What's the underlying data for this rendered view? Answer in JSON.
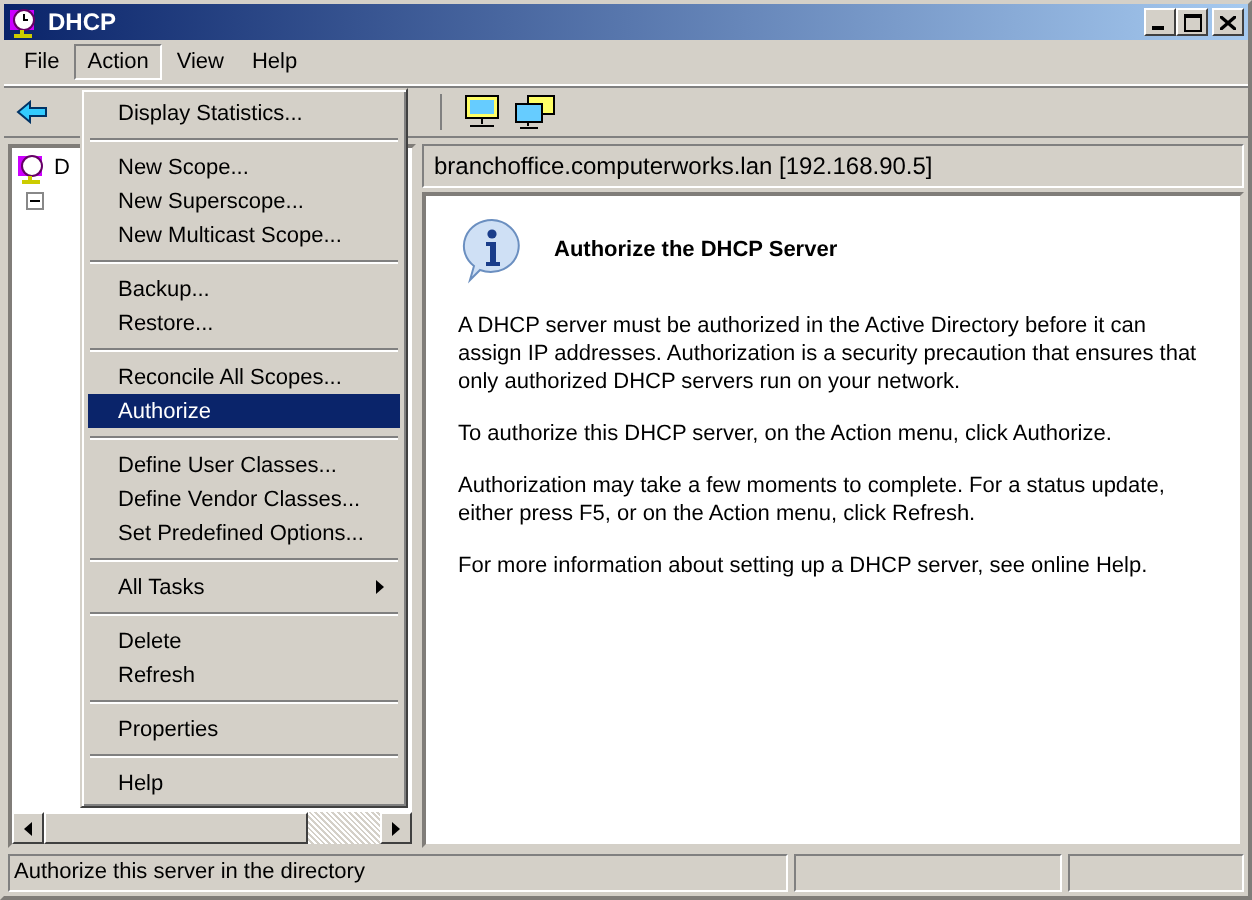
{
  "window": {
    "title": "DHCP"
  },
  "menu_bar": [
    {
      "label": "File",
      "selected": false
    },
    {
      "label": "Action",
      "selected": true
    },
    {
      "label": "View",
      "selected": false
    },
    {
      "label": "Help",
      "selected": false
    }
  ],
  "action_menu": [
    {
      "kind": "item",
      "label": "Display Statistics...",
      "selected": false
    },
    {
      "kind": "separator"
    },
    {
      "kind": "item",
      "label": "New Scope...",
      "selected": false
    },
    {
      "kind": "item",
      "label": "New Superscope...",
      "selected": false
    },
    {
      "kind": "item",
      "label": "New Multicast Scope...",
      "selected": false
    },
    {
      "kind": "separator"
    },
    {
      "kind": "item",
      "label": "Backup...",
      "selected": false
    },
    {
      "kind": "item",
      "label": "Restore...",
      "selected": false
    },
    {
      "kind": "separator"
    },
    {
      "kind": "item",
      "label": "Reconcile All Scopes...",
      "selected": false
    },
    {
      "kind": "item",
      "label": "Authorize",
      "selected": true
    },
    {
      "kind": "separator"
    },
    {
      "kind": "item",
      "label": "Define User Classes...",
      "selected": false
    },
    {
      "kind": "item",
      "label": "Define Vendor Classes...",
      "selected": false
    },
    {
      "kind": "item",
      "label": "Set Predefined Options...",
      "selected": false
    },
    {
      "kind": "separator"
    },
    {
      "kind": "submenu",
      "label": "All Tasks",
      "selected": false
    },
    {
      "kind": "separator"
    },
    {
      "kind": "item",
      "label": "Delete",
      "selected": false
    },
    {
      "kind": "item",
      "label": "Refresh",
      "selected": false
    },
    {
      "kind": "separator"
    },
    {
      "kind": "item",
      "label": "Properties",
      "selected": false
    },
    {
      "kind": "separator"
    },
    {
      "kind": "item",
      "label": "Help",
      "selected": false
    }
  ],
  "tree": {
    "label": "D",
    "expanded": true
  },
  "details": {
    "header": "branchoffice.computerworks.lan [192.168.90.5]",
    "title": "Authorize the DHCP Server",
    "paragraphs": [
      "A DHCP server must be authorized in the Active Directory before it can assign IP addresses. Authorization is a security precaution that ensures that only authorized DHCP servers run on your network.",
      "To authorize this DHCP server, on the Action menu, click Authorize.",
      "Authorization may take a few moments to complete. For a status update, either press F5, or on the Action menu, click Refresh.",
      "For more information about setting up a DHCP server, see online Help."
    ]
  },
  "status_bar": {
    "text": "Authorize this server in the directory"
  }
}
